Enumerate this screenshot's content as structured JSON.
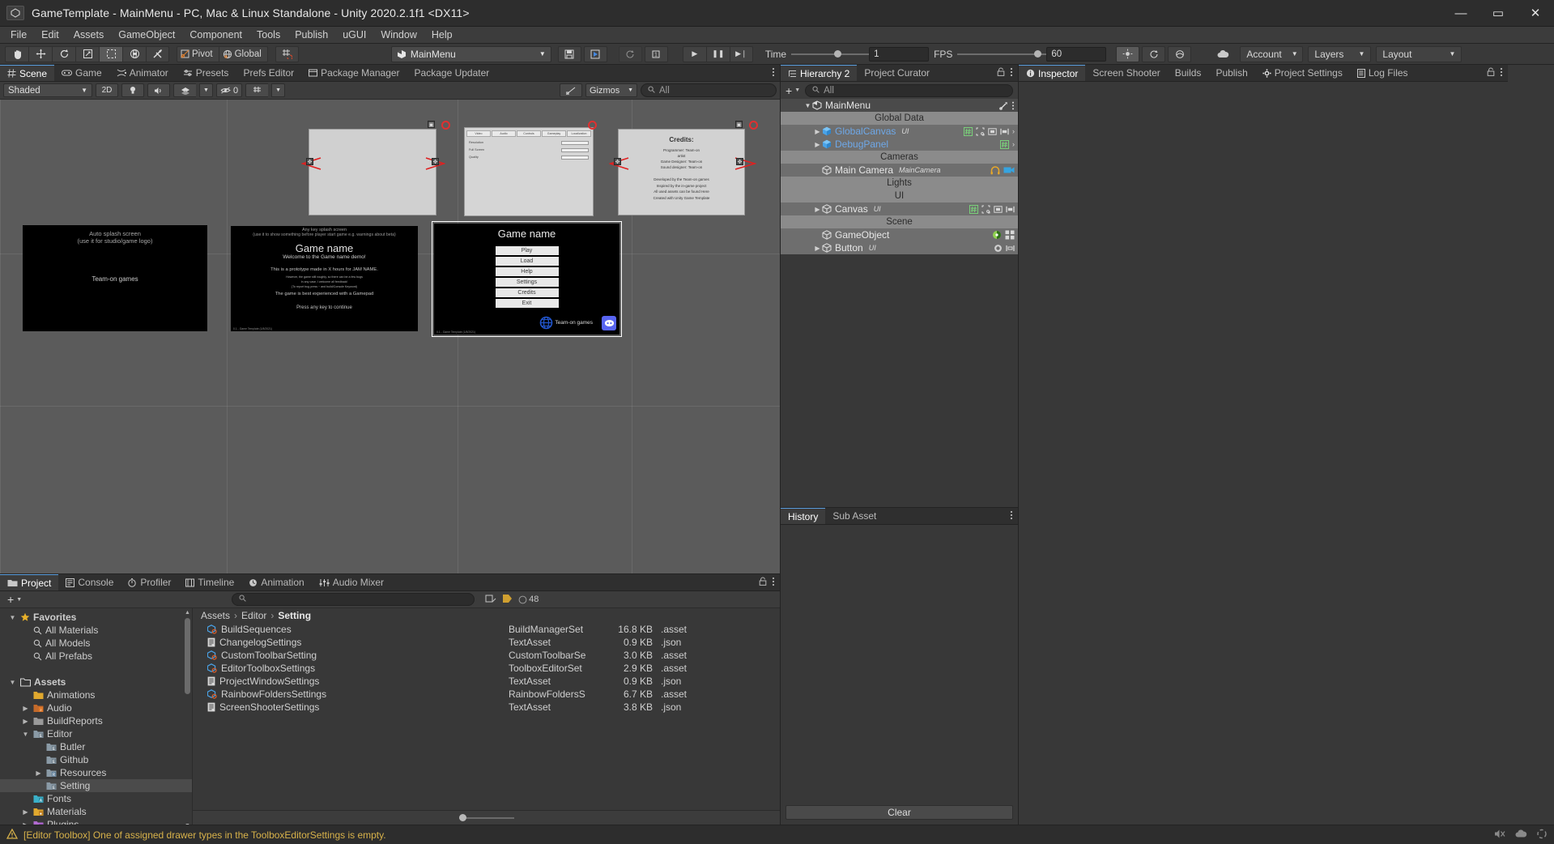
{
  "window": {
    "title": "GameTemplate - MainMenu - PC, Mac & Linux Standalone - Unity 2020.2.1f1 <DX11>",
    "app_icon": "unity-icon",
    "minimize": "—",
    "maximize": "▭",
    "close": "✕"
  },
  "menubar": {
    "items": [
      "File",
      "Edit",
      "Assets",
      "GameObject",
      "Component",
      "Tools",
      "Publish",
      "uGUI",
      "Window",
      "Help"
    ]
  },
  "toolbar": {
    "transform_tools": [
      {
        "name": "hand-tool",
        "glyph": "✋",
        "active": false
      },
      {
        "name": "move-tool",
        "glyph": "✥",
        "active": false
      },
      {
        "name": "rotate-tool",
        "glyph": "↻",
        "active": false
      },
      {
        "name": "scale-tool",
        "glyph": "⤡",
        "active": false
      },
      {
        "name": "rect-tool",
        "glyph": "⬚",
        "active": true
      },
      {
        "name": "transform-tool",
        "glyph": "❂",
        "active": false
      },
      {
        "name": "custom-tool",
        "glyph": "⚒",
        "active": false
      }
    ],
    "pivot_label": "Pivot",
    "global_label": "Global",
    "grid_snap_icon": "grid-snap-icon",
    "scene_selector": "MainMenu",
    "save_icon": "save-icon",
    "save_as_icon": "save-as-icon",
    "refresh_icon": "refresh-icon",
    "layer_count_icon": "1",
    "play_icon": "▶",
    "pause_icon": "❚❚",
    "step_icon": "▶❘",
    "time_label": "Time",
    "time_value": "1",
    "fps_label": "FPS",
    "fps_value": "60",
    "extra_buttons": [
      "brightness-icon",
      "reload-icon",
      "sphere-icon"
    ],
    "cloud_icon": "cloud-icon",
    "account_label": "Account",
    "layers_label": "Layers",
    "layout_label": "Layout"
  },
  "scene_panel": {
    "tabs": [
      {
        "label": "Scene",
        "icon": "grid-icon",
        "active": true
      },
      {
        "label": "Game",
        "icon": "gamepad-icon",
        "active": false
      },
      {
        "label": "Animator",
        "icon": "animator-icon",
        "active": false
      },
      {
        "label": "Presets",
        "icon": "presets-icon",
        "active": false
      },
      {
        "label": "Prefs Editor",
        "icon": "",
        "active": false
      },
      {
        "label": "Package Manager",
        "icon": "package-icon",
        "active": false
      },
      {
        "label": "Package Updater",
        "icon": "",
        "active": false
      }
    ],
    "toolbar": {
      "shading_mode": "Shaded",
      "two_d_label": "2D",
      "light_icon": "light-bulb-icon",
      "audio_icon": "speaker-icon",
      "fx_icon": "effects-icon",
      "hidden_count": "0",
      "hidden_icon": "eye-off-icon",
      "grid_icon": "scene-grid-icon",
      "gizmos_label": "Gizmos",
      "search_placeholder": "All"
    }
  },
  "scene_content": {
    "splash_auto": {
      "title": "Auto splash screen",
      "subtitle": "(use it for studio/game logo)",
      "center": "Team-on games"
    },
    "splash_anykey": {
      "title": "Any key splash screen",
      "subtitle": "(use it to show something before player start game e.g. warnings about beta)",
      "game_name": "Game name",
      "welcome": "Welcome to the Game name demo!",
      "line1": "This is a prototype made in X hours for JAM NAME.",
      "line2": "However, the game still roughly, so there can be a few bugs",
      "line3": "In any case, I welcome all feedback!",
      "line4": "(To report bug press ~ and build/Console Keyword)",
      "line5": "The game is best experienced with a Gamepad",
      "press": "Press any key to continue",
      "version": "0.1 - Game Template (1/8/2021)"
    },
    "mainmenu": {
      "game_name": "Game name",
      "buttons": [
        "Play",
        "Load",
        "Help",
        "Settings",
        "Credits",
        "Exit"
      ],
      "logo_text": "Team-on games",
      "discord_icon": "discord-icon",
      "version": "0.1 - Game Template (1/8/2021)"
    },
    "credits": {
      "title": "Credits:",
      "lines": [
        "Programmer: Team-on",
        "artist",
        "Game Designer: Team-on",
        "Sound designer: Team-on"
      ],
      "footer": [
        "Developed by the Team-on games",
        "Inspired by the in-game project",
        "All used assets can be found Here",
        "Created with  Unity Game Template"
      ]
    },
    "settings": {
      "tabs": [
        "Video",
        "Audio",
        "Controls",
        "Gameplay",
        "Localization"
      ],
      "rows": [
        "Resolution",
        "Full Screen",
        "Quality"
      ]
    }
  },
  "project_panel": {
    "tabs": [
      {
        "label": "Project",
        "icon": "folder-icon",
        "active": true
      },
      {
        "label": "Console",
        "icon": "console-icon",
        "active": false
      },
      {
        "label": "Profiler",
        "icon": "profiler-icon",
        "active": false
      },
      {
        "label": "Timeline",
        "icon": "timeline-icon",
        "active": false
      },
      {
        "label": "Animation",
        "icon": "animation-icon",
        "active": false
      },
      {
        "label": "Audio Mixer",
        "icon": "mixer-icon",
        "active": false
      }
    ],
    "create_label": "+",
    "search_placeholder": "",
    "asset_count": "48",
    "breadcrumbs": [
      "Assets",
      "Editor",
      "Setting"
    ],
    "tree": [
      {
        "label": "Favorites",
        "depth": 0,
        "twisty": "▼",
        "icon": "star-icon",
        "selected": false
      },
      {
        "label": "All Materials",
        "depth": 1,
        "twisty": "",
        "icon": "search-icon",
        "selected": false
      },
      {
        "label": "All Models",
        "depth": 1,
        "twisty": "",
        "icon": "search-icon",
        "selected": false
      },
      {
        "label": "All Prefabs",
        "depth": 1,
        "twisty": "",
        "icon": "search-icon",
        "selected": false
      },
      {
        "label": "",
        "depth": 0,
        "twisty": "",
        "icon": "",
        "selected": false
      },
      {
        "label": "Assets",
        "depth": 0,
        "twisty": "▼",
        "icon": "folder-open-icon",
        "selected": false
      },
      {
        "label": "Animations",
        "depth": 1,
        "twisty": "",
        "icon": "folder-yellow-icon",
        "selected": false
      },
      {
        "label": "Audio",
        "depth": 1,
        "twisty": "▶",
        "icon": "folder-audio-icon",
        "selected": false
      },
      {
        "label": "BuildReports",
        "depth": 1,
        "twisty": "▶",
        "icon": "folder-gray-icon",
        "selected": false
      },
      {
        "label": "Editor",
        "depth": 1,
        "twisty": "▼",
        "icon": "folder-editor-icon",
        "selected": false
      },
      {
        "label": "Butler",
        "depth": 2,
        "twisty": "",
        "icon": "folder-editor-icon",
        "selected": false
      },
      {
        "label": "Github",
        "depth": 2,
        "twisty": "",
        "icon": "folder-editor-icon",
        "selected": false
      },
      {
        "label": "Resources",
        "depth": 2,
        "twisty": "▶",
        "icon": "folder-res-icon",
        "selected": false
      },
      {
        "label": "Setting",
        "depth": 2,
        "twisty": "",
        "icon": "folder-editor-icon",
        "selected": true
      },
      {
        "label": "Fonts",
        "depth": 1,
        "twisty": "",
        "icon": "folder-font-icon",
        "selected": false
      },
      {
        "label": "Materials",
        "depth": 1,
        "twisty": "▶",
        "icon": "folder-mat-icon",
        "selected": false
      },
      {
        "label": "Plugins",
        "depth": 1,
        "twisty": "▶",
        "icon": "folder-plugin-icon",
        "selected": false
      }
    ],
    "assets": [
      {
        "name": "BuildSequences",
        "icon": "scriptable-object-icon",
        "type": "BuildManagerSet",
        "size": "16.8 KB",
        "ext": ".asset"
      },
      {
        "name": "ChangelogSettings",
        "icon": "text-asset-icon",
        "type": "TextAsset",
        "size": "0.9 KB",
        "ext": ".json"
      },
      {
        "name": "CustomToolbarSetting",
        "icon": "scriptable-object-icon",
        "type": "CustomToolbarSe",
        "size": "3.0 KB",
        "ext": ".asset"
      },
      {
        "name": "EditorToolboxSettings",
        "icon": "scriptable-object-icon",
        "type": "ToolboxEditorSet",
        "size": "2.9 KB",
        "ext": ".asset"
      },
      {
        "name": "ProjectWindowSettings",
        "icon": "text-asset-icon",
        "type": "TextAsset",
        "size": "0.9 KB",
        "ext": ".json"
      },
      {
        "name": "RainbowFoldersSettings",
        "icon": "scriptable-object-icon",
        "type": "RainbowFoldersS",
        "size": "6.7 KB",
        "ext": ".asset"
      },
      {
        "name": "ScreenShooterSettings",
        "icon": "text-asset-icon",
        "type": "TextAsset",
        "size": "3.8 KB",
        "ext": ".json"
      }
    ]
  },
  "hierarchy_panel": {
    "tabs": [
      {
        "label": "Hierarchy 2",
        "icon": "hierarchy-icon",
        "active": true
      },
      {
        "label": "Project Curator",
        "icon": "",
        "active": false
      }
    ],
    "lock_icon": "lock-icon",
    "menu_icon": "kebab-icon",
    "create_label": "+",
    "search_placeholder": "All",
    "rows": [
      {
        "label": "MainMenu",
        "kind": "root",
        "depth": 0,
        "twisty": "▼",
        "icon": "unity-scene-icon",
        "tag": "",
        "icons": [
          "target-icon",
          "kebab-icon"
        ]
      },
      {
        "label": "Global Data",
        "kind": "group",
        "depth": 0,
        "twisty": "",
        "icon": "",
        "tag": "",
        "icons": []
      },
      {
        "label": "GlobalCanvas",
        "kind": "item",
        "depth": 1,
        "twisty": "▶",
        "icon": "prefab-cube-icon",
        "tag": "UI",
        "icons": [
          "hash-icon",
          "rect-icon",
          "frame-icon",
          "frame2-icon",
          "chevron-right-icon"
        ]
      },
      {
        "label": "DebugPanel",
        "kind": "item",
        "depth": 1,
        "twisty": "▶",
        "icon": "prefab-cube-icon",
        "tag": "",
        "icons": [
          "hash-icon",
          "chevron-right-icon"
        ]
      },
      {
        "label": "Cameras",
        "kind": "group",
        "depth": 0,
        "twisty": "",
        "icon": "",
        "tag": "",
        "icons": []
      },
      {
        "label": "Main Camera",
        "kind": "item",
        "depth": 1,
        "twisty": "",
        "icon": "gameobject-cube-icon",
        "tag": "MainCamera",
        "icons": [
          "audio-listener-icon",
          "camera-icon"
        ]
      },
      {
        "label": "Lights",
        "kind": "group",
        "depth": 0,
        "twisty": "",
        "icon": "",
        "tag": "",
        "icons": []
      },
      {
        "label": "UI",
        "kind": "group",
        "depth": 0,
        "twisty": "",
        "icon": "",
        "tag": "",
        "icons": []
      },
      {
        "label": "Canvas",
        "kind": "item",
        "depth": 1,
        "twisty": "▶",
        "icon": "gameobject-cube-icon",
        "tag": "UI",
        "icons": [
          "hash-icon",
          "rect-icon",
          "frame-icon",
          "frame2-icon"
        ]
      },
      {
        "label": "Scene",
        "kind": "group",
        "depth": 0,
        "twisty": "",
        "icon": "",
        "tag": "",
        "icons": []
      },
      {
        "label": "GameObject",
        "kind": "item",
        "depth": 1,
        "twisty": "",
        "icon": "gameobject-cube-icon",
        "tag": "",
        "icons": [
          "material-icon",
          "grid4-icon"
        ]
      },
      {
        "label": "Button",
        "kind": "item",
        "depth": 1,
        "twisty": "▶",
        "icon": "gameobject-cube-icon",
        "tag": "UI",
        "icons": [
          "circle-icon",
          "rect2-icon"
        ]
      }
    ]
  },
  "history_panel": {
    "tabs": [
      {
        "label": "History",
        "active": true
      },
      {
        "label": "Sub Asset",
        "active": false
      }
    ],
    "menu_icon": "kebab-icon",
    "clear_label": "Clear"
  },
  "inspector_panel": {
    "tabs": [
      {
        "label": "Inspector",
        "icon": "info-icon",
        "active": true
      },
      {
        "label": "Screen Shooter",
        "icon": "",
        "active": false
      },
      {
        "label": "Builds",
        "icon": "",
        "active": false
      },
      {
        "label": "Publish",
        "icon": "",
        "active": false
      },
      {
        "label": "Project Settings",
        "icon": "gear-icon",
        "active": false
      },
      {
        "label": "Log Files",
        "icon": "log-icon",
        "active": false
      }
    ],
    "lock_icon": "lock-icon",
    "menu_icon": "kebab-icon"
  },
  "statusbar": {
    "icon": "warning-icon",
    "message": "[Editor Toolbox] One of assigned drawer types in the ToolboxEditorSettings is empty.",
    "right_icons": [
      "mute-icon",
      "cloud-status-icon",
      "progress-icon"
    ]
  },
  "colors": {
    "accent_blue": "#5b9fe0",
    "warning": "#d8b24a",
    "panel_bg": "#383838",
    "toolbar_bg": "#393939",
    "group_header": "#8b8b8b"
  }
}
